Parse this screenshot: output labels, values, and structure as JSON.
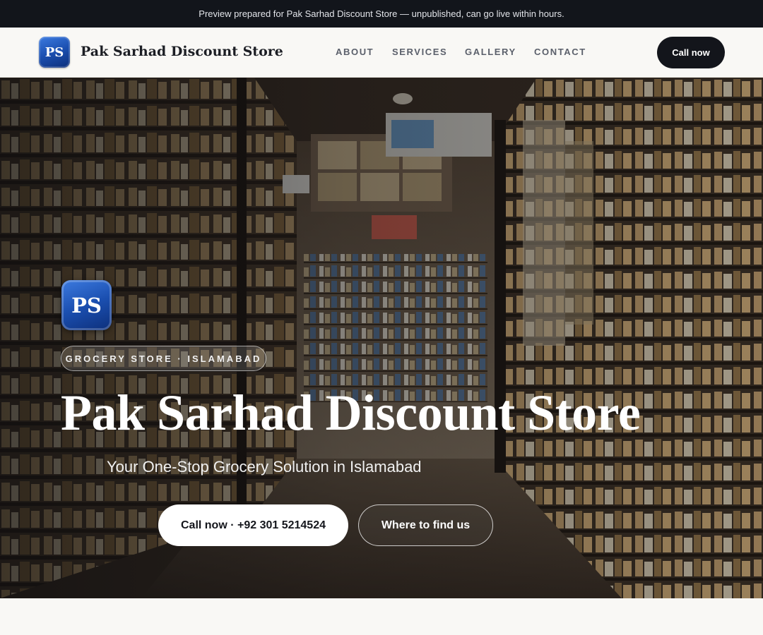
{
  "preview_banner": "Preview prepared for Pak Sarhad Discount Store — unpublished, can go live within hours.",
  "header": {
    "logo_text": "PS",
    "brand_name": "Pak Sarhad Discount Store",
    "nav": [
      "ABOUT",
      "SERVICES",
      "GALLERY",
      "CONTACT"
    ],
    "call_label": "Call now"
  },
  "hero": {
    "logo_text": "PS",
    "tag": "GROCERY STORE · ISLAMABAD",
    "title": "Pak Sarhad Discount Store",
    "subtitle": "Your One-Stop Grocery Solution in Islamabad",
    "primary_button": "Call now · +92 301 5214524",
    "secondary_button": "Where to find us",
    "background": "grocery-store-aisle-photo"
  },
  "colors": {
    "banner_bg": "#12151b",
    "accent_dark": "#13151b",
    "logo_blue": "#1b4fb0",
    "page_bg": "#f9f8f5"
  }
}
